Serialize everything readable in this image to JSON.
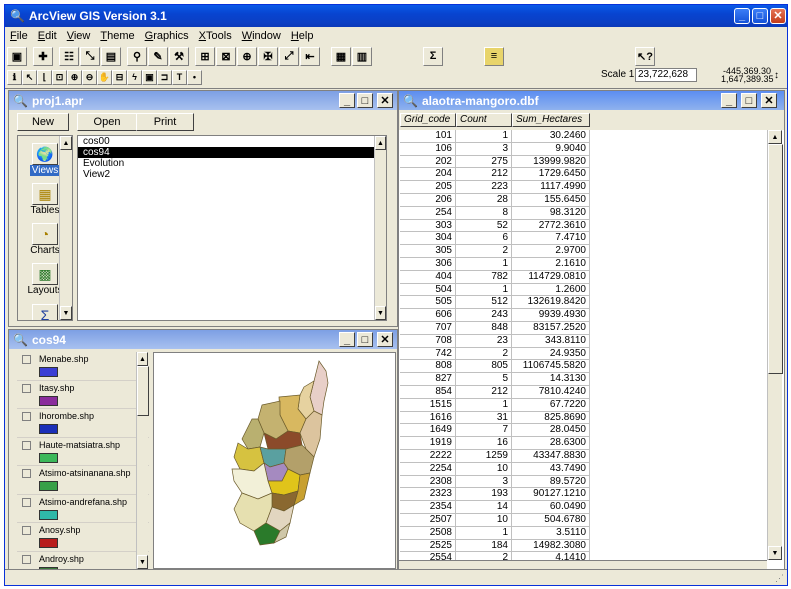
{
  "app": {
    "title": "ArcView GIS Version 3.1"
  },
  "menu": [
    "File",
    "Edit",
    "View",
    "Theme",
    "Graphics",
    "XTools",
    "Window",
    "Help"
  ],
  "toolbar1": [
    "save",
    "add-theme",
    "theme-properties",
    "edit-legend",
    "open-table",
    "find",
    "query",
    "pen",
    "build-query",
    "select",
    "zoom-active",
    "zoom-selected",
    "zoom-out-extent",
    "promote",
    "layout",
    "table-layout",
    "sigma",
    "script",
    "help-pointer"
  ],
  "toolbar1_glyphs": {
    "sigma": "Σ"
  },
  "scale": {
    "label": "Scale 1:",
    "value": "23,722,628",
    "coord_x": "-445,369.30",
    "coord_y": "1,647,389.35"
  },
  "project": {
    "title": "proj1.apr",
    "buttons": {
      "new": "New",
      "open": "Open",
      "print": "Print"
    },
    "sidebar": [
      "Views",
      "Tables",
      "Charts",
      "Layouts"
    ],
    "views": [
      "cos00",
      "cos94",
      "Evolution",
      "View2"
    ],
    "selected_view": "cos94"
  },
  "table": {
    "title": "alaotra-mangoro.dbf",
    "columns": [
      "Grid_code",
      "Count",
      "Sum_Hectares"
    ],
    "rows": [
      [
        "101",
        "1",
        "30.2460"
      ],
      [
        "106",
        "3",
        "9.9040"
      ],
      [
        "202",
        "275",
        "13999.9820"
      ],
      [
        "204",
        "212",
        "1729.6450"
      ],
      [
        "205",
        "223",
        "1117.4990"
      ],
      [
        "206",
        "28",
        "155.6450"
      ],
      [
        "254",
        "8",
        "98.3120"
      ],
      [
        "303",
        "52",
        "2772.3610"
      ],
      [
        "304",
        "6",
        "7.4710"
      ],
      [
        "305",
        "2",
        "2.9700"
      ],
      [
        "306",
        "1",
        "2.1610"
      ],
      [
        "404",
        "782",
        "114729.0810"
      ],
      [
        "504",
        "1",
        "1.2600"
      ],
      [
        "505",
        "512",
        "132619.8420"
      ],
      [
        "606",
        "243",
        "9939.4930"
      ],
      [
        "707",
        "848",
        "83157.2520"
      ],
      [
        "708",
        "23",
        "343.8110"
      ],
      [
        "742",
        "2",
        "24.9350"
      ],
      [
        "808",
        "805",
        "1106745.5820"
      ],
      [
        "827",
        "5",
        "14.3130"
      ],
      [
        "854",
        "212",
        "7810.4240"
      ],
      [
        "1515",
        "1",
        "67.7220"
      ],
      [
        "1616",
        "31",
        "825.8690"
      ],
      [
        "1649",
        "7",
        "28.0450"
      ],
      [
        "1919",
        "16",
        "28.6300"
      ],
      [
        "2222",
        "1259",
        "43347.8830"
      ],
      [
        "2254",
        "10",
        "43.7490"
      ],
      [
        "2308",
        "3",
        "89.5720"
      ],
      [
        "2323",
        "193",
        "90127.1210"
      ],
      [
        "2354",
        "14",
        "60.0490"
      ],
      [
        "2507",
        "10",
        "504.6780"
      ],
      [
        "2508",
        "1",
        "3.5110"
      ],
      [
        "2525",
        "184",
        "14982.3080"
      ],
      [
        "2554",
        "2",
        "4.1410"
      ]
    ]
  },
  "view": {
    "title": "cos94",
    "legend": [
      {
        "name": "Menabe.shp",
        "color": "#3b3fd4"
      },
      {
        "name": "Itasy.shp",
        "color": "#8a2c9c"
      },
      {
        "name": "Ihorombe.shp",
        "color": "#1b2fb8"
      },
      {
        "name": "Haute-matsiatra.shp",
        "color": "#3cb85a"
      },
      {
        "name": "Atsimo-atsinanana.shp",
        "color": "#38a048"
      },
      {
        "name": "Atsimo-andrefana.shp",
        "color": "#2fb8a8"
      },
      {
        "name": "Anosy.shp",
        "color": "#b81c1c"
      },
      {
        "name": "Androy.shp",
        "color": "#3a7a3a"
      }
    ]
  }
}
